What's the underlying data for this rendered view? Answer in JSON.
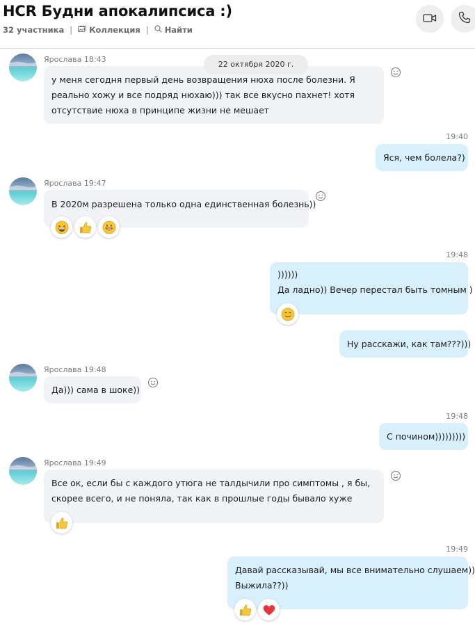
{
  "header": {
    "title": "HCR Будни апокалипсиса :)",
    "participants": "32 участника",
    "collection": "Коллекция",
    "find": "Найти"
  },
  "date_separator": "22 октября 2020 г.",
  "messages": [
    {
      "direction": "in",
      "sender": "Ярослава 18:43",
      "lines": [
        "у меня сегодня первый день возвращения нюха после болезни. Я",
        "реально хожу и все подряд нюхаю))) так все вкусно пахнет! хотя",
        "отсутствие нюха в принципе жизни не мешает"
      ],
      "reactions": []
    },
    {
      "direction": "out",
      "time": "19:40",
      "lines": [
        "Яся, чем болела?)"
      ],
      "reactions": []
    },
    {
      "direction": "in",
      "sender": "Ярослава 19:47",
      "lines": [
        "В 2020м разрешена только одна единственная болезнь))"
      ],
      "reactions": [
        "laughing-face",
        "thumbs-up",
        "grinning-face"
      ]
    },
    {
      "direction": "out",
      "time": "19:48",
      "lines": [
        "))))))",
        "Да ладно)) Вечер перестал быть томным )"
      ],
      "reactions": [
        "smiling-face"
      ]
    },
    {
      "direction": "out",
      "time": "",
      "lines": [
        "Ну расскажи, как там???)))"
      ],
      "reactions": []
    },
    {
      "direction": "in",
      "sender": "Ярослава 19:48",
      "lines": [
        "Да))) сама в шоке))"
      ],
      "reactions": []
    },
    {
      "direction": "out",
      "time": "19:48",
      "lines": [
        "С почином)))))))))"
      ],
      "reactions": []
    },
    {
      "direction": "in",
      "sender": "Ярослава 19:49",
      "lines": [
        "Все ок, если бы с каждого утюга не талдычили про симптомы , я бы,",
        "скорее всего, и не поняла, так как в прошлые годы бывало хуже"
      ],
      "reactions": [
        "thumbs-up"
      ]
    },
    {
      "direction": "out",
      "time": "19:49",
      "lines": [
        "Давай рассказывай, мы все внимательно слушаем))",
        "Выжила??))"
      ],
      "reactions": [
        "thumbs-up",
        "red-heart"
      ]
    }
  ],
  "colors": {
    "incoming_bubble": "#f1f3f6",
    "outgoing_bubble": "#d8f0fb",
    "emoji_yellow": "#f7c739",
    "heart_red": "#e8323c"
  }
}
